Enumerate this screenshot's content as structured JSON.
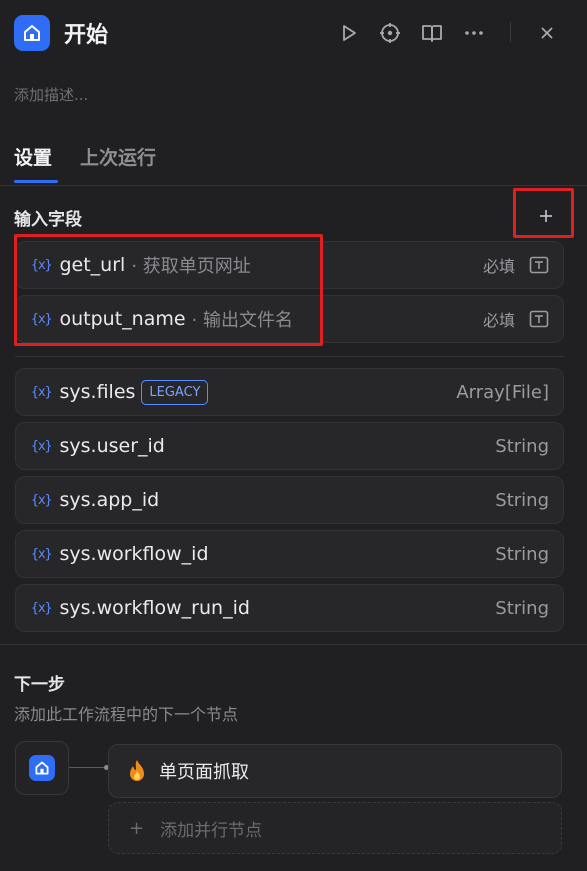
{
  "header": {
    "title": "开始",
    "icons": [
      "home-icon",
      "run-icon",
      "locate-icon",
      "book-icon",
      "more-icon",
      "close-icon"
    ]
  },
  "description_placeholder": "添加描述...",
  "tabs": [
    {
      "label": "设置",
      "active": true
    },
    {
      "label": "上次运行",
      "active": false
    }
  ],
  "input_fields": {
    "title": "输入字段",
    "add_icon": "plus-icon",
    "user_fields": [
      {
        "name": "get_url",
        "label": "· 获取单页网址",
        "required": "必填",
        "type_icon": "text-input-icon"
      },
      {
        "name": "output_name",
        "label": "· 输出文件名",
        "required": "必填",
        "type_icon": "text-input-icon"
      }
    ],
    "system_fields": [
      {
        "name": "sys.files",
        "badge": "LEGACY",
        "type": "Array[File]"
      },
      {
        "name": "sys.user_id",
        "type": "String"
      },
      {
        "name": "sys.app_id",
        "type": "String"
      },
      {
        "name": "sys.workflow_id",
        "type": "String"
      },
      {
        "name": "sys.workflow_run_id",
        "type": "String"
      }
    ],
    "var_icon_text": "{x}"
  },
  "next_step": {
    "title": "下一步",
    "subtitle": "添加此工作流程中的下一个节点",
    "next_node": {
      "label": "单页面抓取",
      "icon": "fire-icon"
    },
    "add_parallel": {
      "label": "添加并行节点",
      "icon": "plus-icon"
    }
  },
  "colors": {
    "accent": "#2f6df6",
    "background": "#202022",
    "annotation": "#e02020"
  }
}
